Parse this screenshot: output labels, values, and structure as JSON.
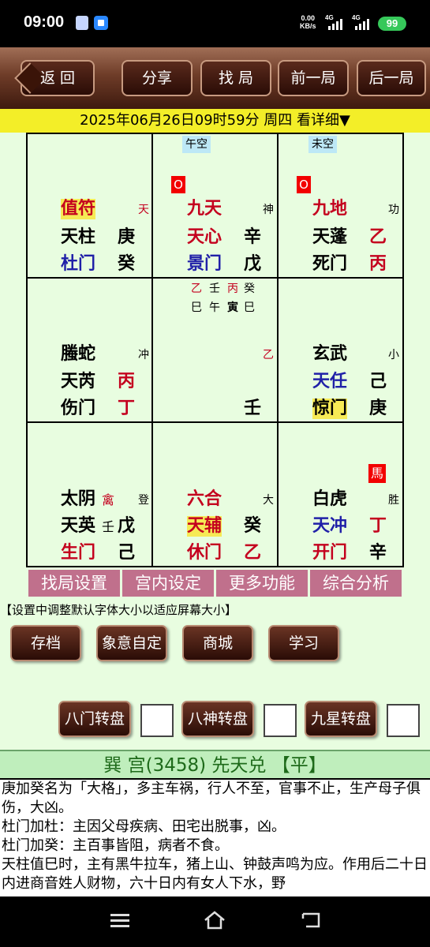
{
  "status": {
    "time": "09:00",
    "speed": "0.00\nKB/s",
    "net1": "4G",
    "net2": "4G",
    "battery": "99"
  },
  "toolbar": {
    "back": "返 回",
    "share": "分享",
    "find": "找 局",
    "prev": "前一局",
    "next": "后一局"
  },
  "datebar": "2025年06月26日09时59分 周四 看详细▼",
  "cells": {
    "c1": {
      "god": "值符",
      "god_tag": "天",
      "star": "天柱",
      "star_stem": "庚",
      "door": "杜门",
      "door_stem": "癸"
    },
    "c2": {
      "kong": "午空",
      "zero": "O",
      "god": "九天",
      "god_tag": "神",
      "star": "天心",
      "star_stem": "辛",
      "door": "景门",
      "door_stem": "戊"
    },
    "c3": {
      "kong": "未空",
      "zero": "O",
      "god": "九地",
      "god_tag": "功",
      "star": "天蓬",
      "star_stem": "乙",
      "door": "死门",
      "door_stem": "丙"
    },
    "c4": {
      "god": "螣蛇",
      "god_tag": "冲",
      "star": "天芮",
      "star_stem": "丙",
      "door": "伤门",
      "door_stem": "丁"
    },
    "c5": {
      "row1": [
        "乙",
        "壬",
        "丙",
        "癸"
      ],
      "row2": [
        "巳",
        "午",
        "寅",
        "巳"
      ],
      "mid_stem": "乙",
      "bottom_stem": "壬"
    },
    "c6": {
      "god": "玄武",
      "god_tag": "小",
      "star": "天任",
      "star_stem": "己",
      "door": "惊门",
      "door_stem": "庚"
    },
    "c7": {
      "god": "太阴",
      "god_mark": "禽",
      "god_tag": "登",
      "star": "天英",
      "star_extra": "壬",
      "star_stem": "戊",
      "door": "生门",
      "door_stem": "己"
    },
    "c8": {
      "god": "六合",
      "god_tag": "大",
      "star": "天辅",
      "star_stem": "癸",
      "door": "休门",
      "door_stem": "乙"
    },
    "c9": {
      "horse": "馬",
      "god": "白虎",
      "god_tag": "胜",
      "star": "天冲",
      "star_stem": "丁",
      "door": "开门",
      "door_stem": "辛"
    }
  },
  "menu": [
    "找局设置",
    "宫内设定",
    "更多功能",
    "综合分析"
  ],
  "hint": "【设置中调整默认字体大小以适应屏幕大小】",
  "buttons": {
    "save": "存档",
    "meaning": "象意自定",
    "shop": "商城",
    "learn": "学习"
  },
  "rotate": {
    "door": "八门转盘",
    "god": "八神转盘",
    "star": "九星转盘"
  },
  "palace_title": "巽 宫(3458) 先天兑 【平】",
  "description": [
    "庚加癸名为「大格」，多主车祸，行人不至，官事不止，生产母子俱伤，大凶。",
    "杜门加杜：主因父母疾病、田宅出脱事，凶。",
    "杜门加癸：主百事皆阻，病者不食。",
    "天柱值巳时，主有黑牛拉车，猪上山、钟鼓声鸣为应。作用后二十日内进商音姓人财物，六十日内有女人下水，野"
  ],
  "colors": {
    "toolbar": "#6e3c28",
    "datebar": "#f3ee28",
    "panel": "#e8fde0",
    "menu": "#c0708c",
    "red": "#c4001e",
    "blue": "#2020a8"
  }
}
